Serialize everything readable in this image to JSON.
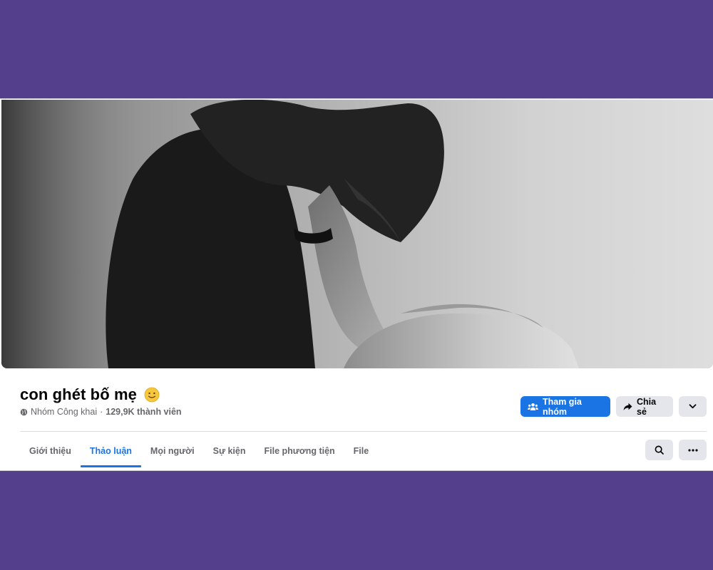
{
  "group": {
    "name": "con ghét bố mẹ",
    "privacy": "Nhóm Công khai",
    "separator": "·",
    "members": "129,9K thành viên"
  },
  "actions": {
    "join_label": "Tham gia nhóm",
    "share_label": "Chia sẻ"
  },
  "tabs": [
    {
      "label": "Giới thiệu"
    },
    {
      "label": "Thảo luận"
    },
    {
      "label": "Mọi người"
    },
    {
      "label": "Sự kiện"
    },
    {
      "label": "File phương tiện"
    },
    {
      "label": "File"
    }
  ],
  "active_tab": "Thảo luận",
  "icons": {
    "emoji": "slightly-smiling-face-icon",
    "privacy": "globe-icon",
    "join": "group-people-icon",
    "share": "share-arrow-icon",
    "dropdown": "chevron-down-icon",
    "search": "search-icon",
    "more": "more-dots-icon"
  },
  "colors": {
    "background": "#533f8c",
    "accent": "#1b74e4",
    "button_gray": "#e4e6eb",
    "text_secondary": "#65676b"
  }
}
